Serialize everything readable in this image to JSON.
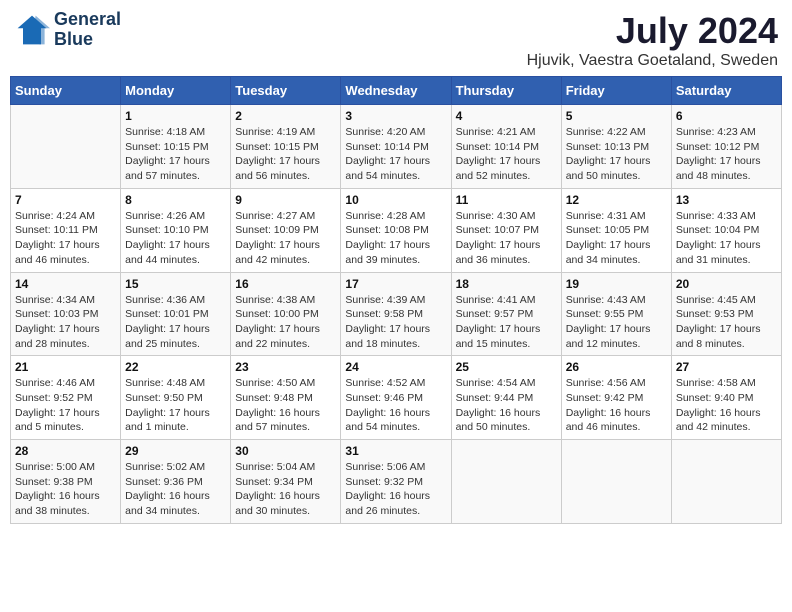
{
  "header": {
    "logo_line1": "General",
    "logo_line2": "Blue",
    "title": "July 2024",
    "subtitle": "Hjuvik, Vaestra Goetaland, Sweden"
  },
  "calendar": {
    "columns": [
      "Sunday",
      "Monday",
      "Tuesday",
      "Wednesday",
      "Thursday",
      "Friday",
      "Saturday"
    ],
    "rows": [
      [
        {
          "day": "",
          "info": ""
        },
        {
          "day": "1",
          "info": "Sunrise: 4:18 AM\nSunset: 10:15 PM\nDaylight: 17 hours\nand 57 minutes."
        },
        {
          "day": "2",
          "info": "Sunrise: 4:19 AM\nSunset: 10:15 PM\nDaylight: 17 hours\nand 56 minutes."
        },
        {
          "day": "3",
          "info": "Sunrise: 4:20 AM\nSunset: 10:14 PM\nDaylight: 17 hours\nand 54 minutes."
        },
        {
          "day": "4",
          "info": "Sunrise: 4:21 AM\nSunset: 10:14 PM\nDaylight: 17 hours\nand 52 minutes."
        },
        {
          "day": "5",
          "info": "Sunrise: 4:22 AM\nSunset: 10:13 PM\nDaylight: 17 hours\nand 50 minutes."
        },
        {
          "day": "6",
          "info": "Sunrise: 4:23 AM\nSunset: 10:12 PM\nDaylight: 17 hours\nand 48 minutes."
        }
      ],
      [
        {
          "day": "7",
          "info": "Sunrise: 4:24 AM\nSunset: 10:11 PM\nDaylight: 17 hours\nand 46 minutes."
        },
        {
          "day": "8",
          "info": "Sunrise: 4:26 AM\nSunset: 10:10 PM\nDaylight: 17 hours\nand 44 minutes."
        },
        {
          "day": "9",
          "info": "Sunrise: 4:27 AM\nSunset: 10:09 PM\nDaylight: 17 hours\nand 42 minutes."
        },
        {
          "day": "10",
          "info": "Sunrise: 4:28 AM\nSunset: 10:08 PM\nDaylight: 17 hours\nand 39 minutes."
        },
        {
          "day": "11",
          "info": "Sunrise: 4:30 AM\nSunset: 10:07 PM\nDaylight: 17 hours\nand 36 minutes."
        },
        {
          "day": "12",
          "info": "Sunrise: 4:31 AM\nSunset: 10:05 PM\nDaylight: 17 hours\nand 34 minutes."
        },
        {
          "day": "13",
          "info": "Sunrise: 4:33 AM\nSunset: 10:04 PM\nDaylight: 17 hours\nand 31 minutes."
        }
      ],
      [
        {
          "day": "14",
          "info": "Sunrise: 4:34 AM\nSunset: 10:03 PM\nDaylight: 17 hours\nand 28 minutes."
        },
        {
          "day": "15",
          "info": "Sunrise: 4:36 AM\nSunset: 10:01 PM\nDaylight: 17 hours\nand 25 minutes."
        },
        {
          "day": "16",
          "info": "Sunrise: 4:38 AM\nSunset: 10:00 PM\nDaylight: 17 hours\nand 22 minutes."
        },
        {
          "day": "17",
          "info": "Sunrise: 4:39 AM\nSunset: 9:58 PM\nDaylight: 17 hours\nand 18 minutes."
        },
        {
          "day": "18",
          "info": "Sunrise: 4:41 AM\nSunset: 9:57 PM\nDaylight: 17 hours\nand 15 minutes."
        },
        {
          "day": "19",
          "info": "Sunrise: 4:43 AM\nSunset: 9:55 PM\nDaylight: 17 hours\nand 12 minutes."
        },
        {
          "day": "20",
          "info": "Sunrise: 4:45 AM\nSunset: 9:53 PM\nDaylight: 17 hours\nand 8 minutes."
        }
      ],
      [
        {
          "day": "21",
          "info": "Sunrise: 4:46 AM\nSunset: 9:52 PM\nDaylight: 17 hours\nand 5 minutes."
        },
        {
          "day": "22",
          "info": "Sunrise: 4:48 AM\nSunset: 9:50 PM\nDaylight: 17 hours\nand 1 minute."
        },
        {
          "day": "23",
          "info": "Sunrise: 4:50 AM\nSunset: 9:48 PM\nDaylight: 16 hours\nand 57 minutes."
        },
        {
          "day": "24",
          "info": "Sunrise: 4:52 AM\nSunset: 9:46 PM\nDaylight: 16 hours\nand 54 minutes."
        },
        {
          "day": "25",
          "info": "Sunrise: 4:54 AM\nSunset: 9:44 PM\nDaylight: 16 hours\nand 50 minutes."
        },
        {
          "day": "26",
          "info": "Sunrise: 4:56 AM\nSunset: 9:42 PM\nDaylight: 16 hours\nand 46 minutes."
        },
        {
          "day": "27",
          "info": "Sunrise: 4:58 AM\nSunset: 9:40 PM\nDaylight: 16 hours\nand 42 minutes."
        }
      ],
      [
        {
          "day": "28",
          "info": "Sunrise: 5:00 AM\nSunset: 9:38 PM\nDaylight: 16 hours\nand 38 minutes."
        },
        {
          "day": "29",
          "info": "Sunrise: 5:02 AM\nSunset: 9:36 PM\nDaylight: 16 hours\nand 34 minutes."
        },
        {
          "day": "30",
          "info": "Sunrise: 5:04 AM\nSunset: 9:34 PM\nDaylight: 16 hours\nand 30 minutes."
        },
        {
          "day": "31",
          "info": "Sunrise: 5:06 AM\nSunset: 9:32 PM\nDaylight: 16 hours\nand 26 minutes."
        },
        {
          "day": "",
          "info": ""
        },
        {
          "day": "",
          "info": ""
        },
        {
          "day": "",
          "info": ""
        }
      ]
    ]
  }
}
